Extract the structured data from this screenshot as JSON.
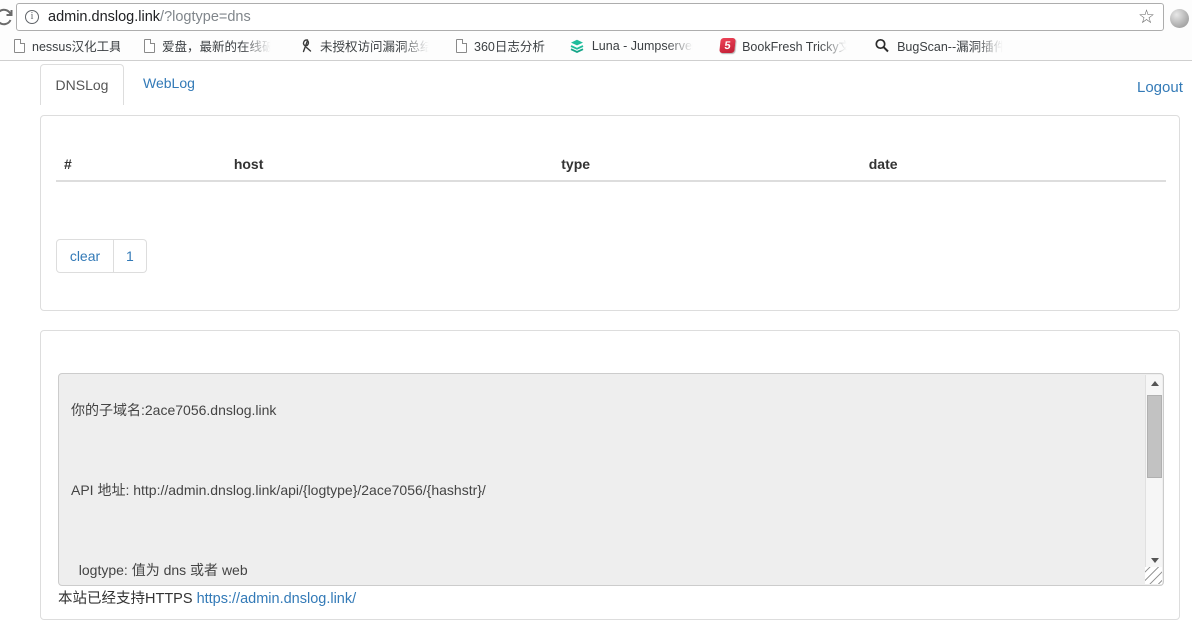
{
  "browser": {
    "address": {
      "host": "admin.dnslog.link",
      "path": "/?logtype=dns"
    },
    "bookmarks": [
      {
        "icon": "page-icon",
        "label": "nessus汉化工具",
        "truncated": false
      },
      {
        "icon": "page-icon",
        "label": "爱盘，最新的在线破",
        "truncated": true
      },
      {
        "icon": "signature-icon",
        "label": "未授权访问漏洞总结",
        "truncated": true
      },
      {
        "icon": "page-icon",
        "label": "360日志分析",
        "truncated": false
      },
      {
        "icon": "layers-icon",
        "label": "Luna - Jumpserver",
        "truncated": true
      },
      {
        "icon": "red-5-icon",
        "icon_glyph": "5",
        "label": "BookFresh Tricky文",
        "truncated": true
      },
      {
        "icon": "magnifier-icon",
        "label": "BugScan--漏洞插件",
        "truncated": true
      }
    ]
  },
  "page": {
    "tabs": [
      {
        "label": "DNSLog",
        "active": true
      },
      {
        "label": "WebLog",
        "active": false
      }
    ],
    "logout_label": "Logout",
    "log_table": {
      "columns": [
        "#",
        "host",
        "type",
        "date"
      ],
      "rows": []
    },
    "pagination": {
      "clear_label": "clear",
      "page_label": "1"
    },
    "info_text": "你的子域名:2ace7056.dnslog.link\n\n\n\nAPI 地址: http://admin.dnslog.link/api/{logtype}/2ace7056/{hashstr}/\n\n\n\n  logtype: 值为 dns 或者 web",
    "footer": {
      "text": "本站已经支持HTTPS ",
      "link_label": "https://admin.dnslog.link/"
    }
  },
  "colors": {
    "link_blue": "#337ab7",
    "panel_border": "#dddddd",
    "textarea_bg": "#eeeeee",
    "header_text": "#333333"
  }
}
